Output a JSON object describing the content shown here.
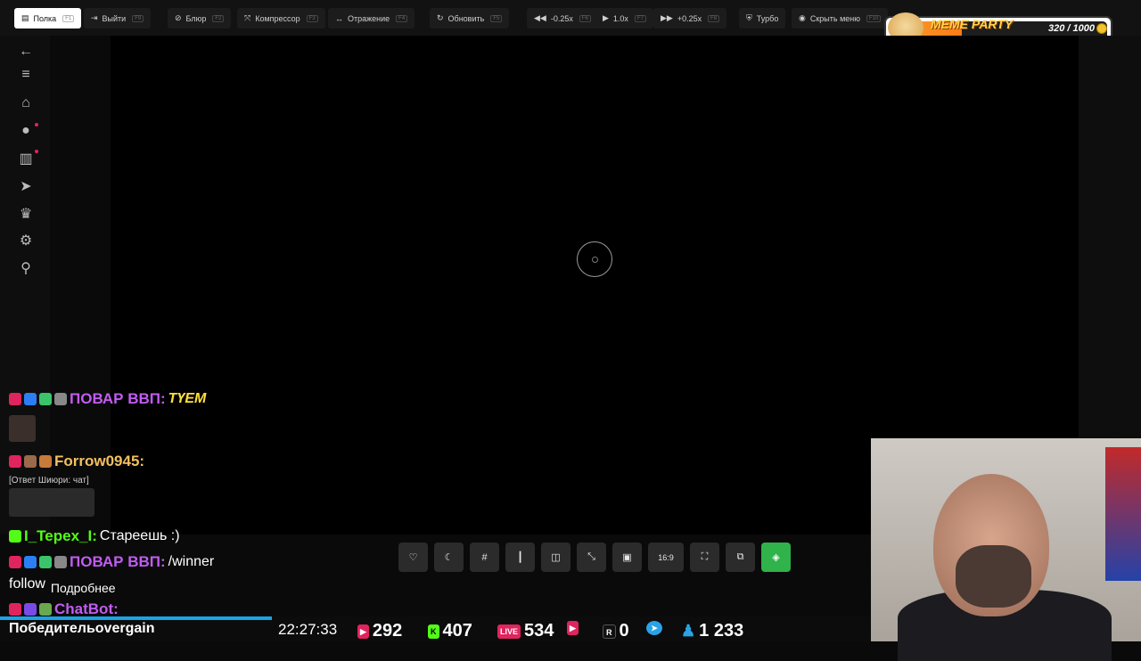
{
  "topbar": {
    "buttons": [
      {
        "label": "Полка",
        "key": "F1",
        "icon": "shelf-icon"
      },
      {
        "label": "Выйти",
        "key": "F9",
        "icon": "exit-icon"
      },
      {
        "label": "Блюр",
        "key": "F2",
        "icon": "blur-icon"
      },
      {
        "label": "Компрессор",
        "key": "F3",
        "icon": "compressor-icon"
      },
      {
        "label": "Отражение",
        "key": "F4",
        "icon": "mirror-icon"
      },
      {
        "label": "Обновить",
        "key": "F5",
        "icon": "refresh-icon"
      },
      {
        "label": "-0.25x",
        "key": "F6",
        "icon": "rewind-icon"
      },
      {
        "label": "1.0x",
        "key": "F7",
        "icon": "play-icon"
      },
      {
        "label": "+0.25x",
        "key": "F8",
        "icon": "forward-icon"
      },
      {
        "label": "Турбо",
        "key": "",
        "icon": "turbo-icon"
      },
      {
        "label": "Скрыть меню",
        "key": "F10",
        "icon": "eye-icon"
      }
    ]
  },
  "sidebar": {
    "items": [
      "back-icon",
      "menu-icon",
      "home-icon",
      "fire-icon",
      "book-icon",
      "telegram-icon",
      "trophy-icon",
      "settings-icon",
      "search-icon"
    ]
  },
  "meme_party": {
    "title": "MEME PARTY",
    "count": "320 / 1000",
    "progress": 0.32
  },
  "controls": {
    "items": [
      "heart-icon",
      "moon-icon",
      "grid-icon",
      "audio-icon",
      "split-icon",
      "resize-icon",
      "pip-icon",
      "aspect-ratio",
      "fullscreen-icon",
      "copy-icon",
      "layers-icon"
    ],
    "aspect_label": "16:9"
  },
  "chat": {
    "messages": [
      {
        "nick": "ПОВАР ВВП:",
        "text": "ТҮЕМ",
        "nick_color": "#c25cf2"
      },
      {
        "nick": "Forrow0945:",
        "text": "",
        "nick_color": "#f2c060",
        "reply": "[Ответ Шиюри: чат]"
      },
      {
        "nick": "I_Tepex_I:",
        "text": "Стареешь :)",
        "nick_color": "#53fc18"
      },
      {
        "nick": "ПОВАР ВВП:",
        "text": "/winner",
        "nick_color": "#c25cf2"
      },
      {
        "nick": "",
        "text": "follow",
        "extra": "Подробнее"
      },
      {
        "nick": "ChatBot:",
        "text": "",
        "nick_color": "#c25cf2"
      }
    ],
    "winner_text": "Победительovergain"
  },
  "bottombar": {
    "time": "22:27:33",
    "youtube": "292",
    "kick": "407",
    "vk_live": "534",
    "vk_video": "",
    "rutube": "0",
    "telegram": "",
    "viewers": "1 233",
    "live_label": "LIVE"
  }
}
